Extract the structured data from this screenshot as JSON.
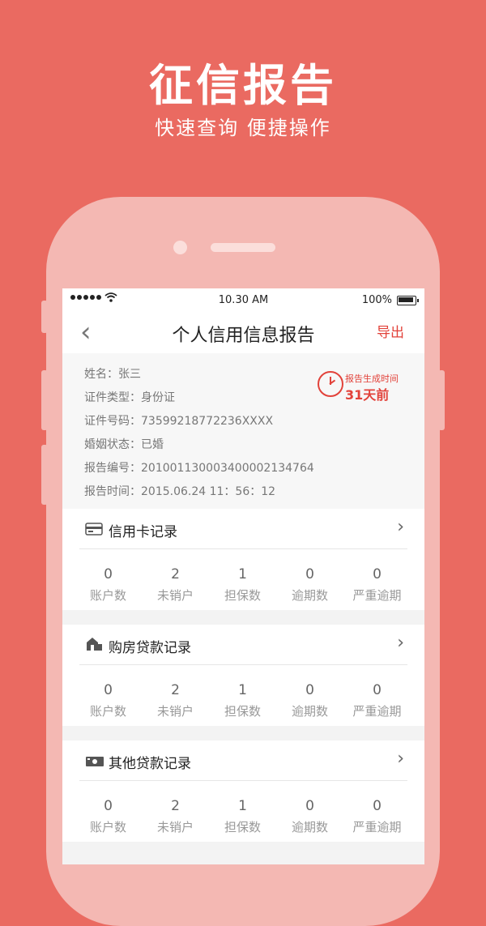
{
  "promo": {
    "title": "征信报告",
    "subtitle": "快速查询 便捷操作"
  },
  "statusbar": {
    "time": "10.30 AM",
    "battery": "100%"
  },
  "navbar": {
    "back": "‹",
    "title": "个人信用信息报告",
    "export": "导出"
  },
  "info": {
    "name": "姓名：张三",
    "id_type": "证件类型：身份证",
    "id_number": "证件号码：73599218772236XXXX",
    "marital": "婚姻状态：已婚",
    "report_no": "报告编号：2010011300034000021347​64",
    "report_time": "报告时间：2015.06.24  11：56：12",
    "generated_label": "报告生成时间",
    "generated_value": "31天前"
  },
  "sections": [
    {
      "title": "信用卡记录",
      "icon": "credit-card-icon",
      "stats": [
        {
          "value": "0",
          "label": "账户数"
        },
        {
          "value": "2",
          "label": "未销户"
        },
        {
          "value": "1",
          "label": "担保数"
        },
        {
          "value": "0",
          "label": "逾期数"
        },
        {
          "value": "0",
          "label": "严重逾期"
        }
      ]
    },
    {
      "title": "购房贷款记录",
      "icon": "house-icon",
      "stats": [
        {
          "value": "0",
          "label": "账户数"
        },
        {
          "value": "2",
          "label": "未销户"
        },
        {
          "value": "1",
          "label": "担保数"
        },
        {
          "value": "0",
          "label": "逾期数"
        },
        {
          "value": "0",
          "label": "严重逾期"
        }
      ]
    },
    {
      "title": "其他贷款记录",
      "icon": "cash-icon",
      "stats": [
        {
          "value": "0",
          "label": "账户数"
        },
        {
          "value": "2",
          "label": "未销户"
        },
        {
          "value": "1",
          "label": "担保数"
        },
        {
          "value": "0",
          "label": "逾期数"
        },
        {
          "value": "0",
          "label": "严重逾期"
        }
      ]
    }
  ],
  "colors": {
    "background": "#ea6a61",
    "phone_body": "#f4b8b3",
    "accent": "#e2423a"
  }
}
